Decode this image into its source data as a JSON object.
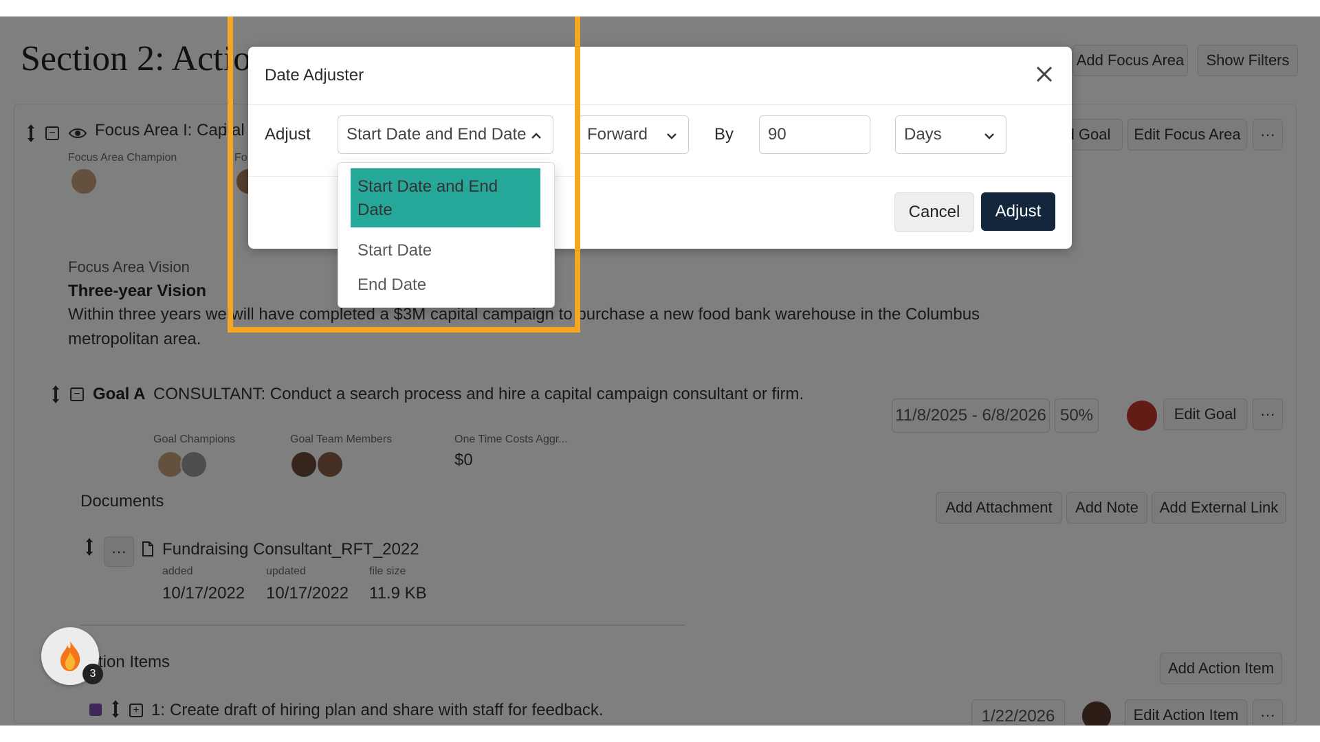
{
  "page": {
    "section_title": "Section 2: Actio",
    "top_buttons": {
      "add_focus_area": "Add Focus Area",
      "show_filters": "Show Filters"
    },
    "focus_area": {
      "title": "Focus Area I: Cap",
      "suffix_title": "ital",
      "champion_label": "Focus Area Champion",
      "second_label": "Fo",
      "buttons": {
        "add_goal": "d Goal",
        "edit_focus_area": "Edit Focus Area",
        "more": "···"
      },
      "vision_label": "Focus Area Vision",
      "vision_heading": "Three-year Vision",
      "vision_text_line1": "Within three years we will have completed a $3M capital campaign to purchase a new food bank warehouse in the Columbus",
      "vision_text_line2": "metropolitan area."
    },
    "goal": {
      "label": "Goal A",
      "text": "CONSULTANT: Conduct a search process and hire a capital campaign consultant or firm.",
      "date_range": "11/8/2025 - 6/8/2026",
      "percent": "50%",
      "edit_button": "Edit Goal",
      "more": "···",
      "champions_label": "Goal Champions",
      "team_label": "Goal Team Members",
      "costs_label": "One Time Costs Aggr...",
      "costs_value": "$0"
    },
    "documents": {
      "title": "Documents",
      "buttons": {
        "add_attachment": "Add Attachment",
        "add_note": "Add Note",
        "add_external_link": "Add External Link"
      },
      "file_name": "Fundraising Consultant_RFT_2022",
      "added_label": "added",
      "updated_label": "updated",
      "size_label": "file size",
      "added_value": "10/17/2022",
      "updated_value": "10/17/2022",
      "size_value": "11.9 KB",
      "more": "···"
    },
    "action_items": {
      "title": "tion Items",
      "add_button": "Add Action Item",
      "item_index": "1:",
      "item_text": "Create draft of hiring plan and share with staff for feedback.",
      "item_date": "1/22/2026",
      "edit_button": "Edit Action Item",
      "more": "···"
    },
    "notification_count": "3"
  },
  "modal": {
    "title": "Date Adjuster",
    "adjust_label": "Adjust",
    "adjust_select_value": "Start Date and End Date",
    "direction_value": "Forward",
    "by_label": "By",
    "amount_value": "90",
    "unit_value": "Days",
    "cancel_label": "Cancel",
    "adjust_button_label": "Adjust",
    "dropdown_options": [
      "Start Date and End Date",
      "Start Date",
      "End Date"
    ]
  },
  "colors": {
    "highlight": "#f5a623",
    "selected_option": "#1aa394",
    "primary_button": "#14263b",
    "goal_status": "#c0392b"
  }
}
